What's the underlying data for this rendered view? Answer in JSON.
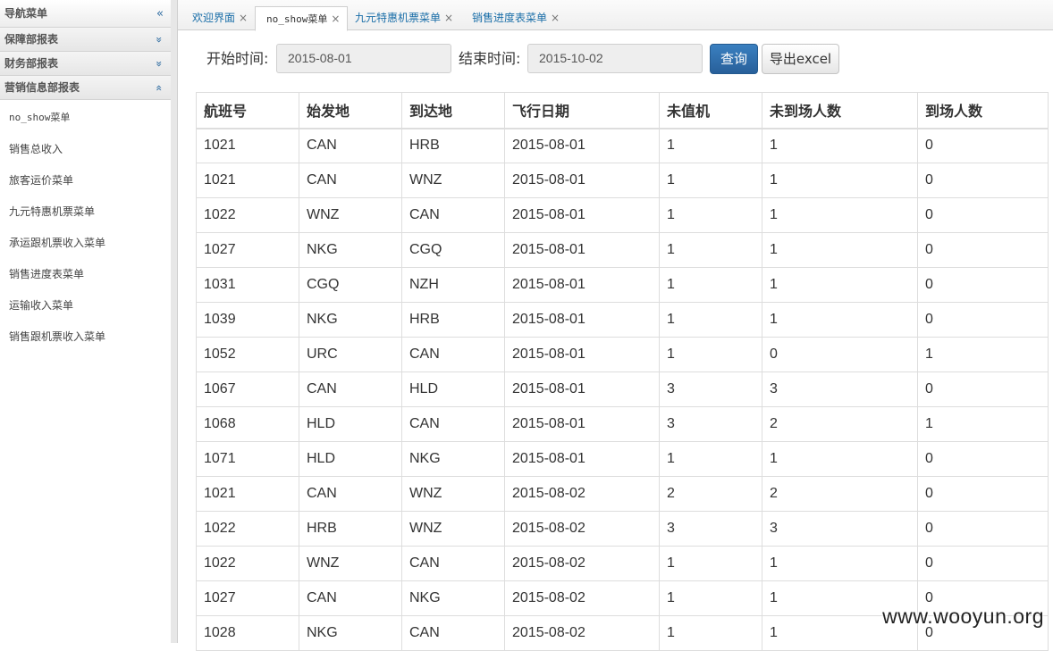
{
  "sidebar": {
    "title": "导航菜单",
    "collapse_icon": "«",
    "groups": [
      {
        "label": "保障部报表",
        "icon": "»"
      },
      {
        "label": "财务部报表",
        "icon": "»"
      },
      {
        "label": "营销信息部报表",
        "icon": "«"
      }
    ],
    "items": [
      {
        "label": "no_show菜单"
      },
      {
        "label": "销售总收入"
      },
      {
        "label": "旅客运价菜单"
      },
      {
        "label": "九元特惠机票菜单"
      },
      {
        "label": "承运跟机票收入菜单"
      },
      {
        "label": "销售进度表菜单"
      },
      {
        "label": "运输收入菜单"
      },
      {
        "label": "销售跟机票收入菜单"
      }
    ]
  },
  "tabs": [
    {
      "label": "欢迎界面",
      "close": "×"
    },
    {
      "label": "no_show菜单",
      "close": "×"
    },
    {
      "label": "九元特惠机票菜单",
      "close": "×"
    },
    {
      "label": "销售进度表菜单",
      "close": "×"
    }
  ],
  "filter": {
    "start_label": "开始时间:",
    "start_value": "2015-08-01",
    "end_label": "结束时间:",
    "end_value": "2015-10-02",
    "query_label": "查询",
    "export_label": "导出excel"
  },
  "table": {
    "headers": [
      "航班号",
      "始发地",
      "到达地",
      "飞行日期",
      "未值机",
      "未到场人数",
      "到场人数"
    ],
    "rows": [
      [
        "1021",
        "CAN",
        "HRB",
        "2015-08-01",
        "1",
        "1",
        "0"
      ],
      [
        "1021",
        "CAN",
        "WNZ",
        "2015-08-01",
        "1",
        "1",
        "0"
      ],
      [
        "1022",
        "WNZ",
        "CAN",
        "2015-08-01",
        "1",
        "1",
        "0"
      ],
      [
        "1027",
        "NKG",
        "CGQ",
        "2015-08-01",
        "1",
        "1",
        "0"
      ],
      [
        "1031",
        "CGQ",
        "NZH",
        "2015-08-01",
        "1",
        "1",
        "0"
      ],
      [
        "1039",
        "NKG",
        "HRB",
        "2015-08-01",
        "1",
        "1",
        "0"
      ],
      [
        "1052",
        "URC",
        "CAN",
        "2015-08-01",
        "1",
        "0",
        "1"
      ],
      [
        "1067",
        "CAN",
        "HLD",
        "2015-08-01",
        "3",
        "3",
        "0"
      ],
      [
        "1068",
        "HLD",
        "CAN",
        "2015-08-01",
        "3",
        "2",
        "1"
      ],
      [
        "1071",
        "HLD",
        "NKG",
        "2015-08-01",
        "1",
        "1",
        "0"
      ],
      [
        "1021",
        "CAN",
        "WNZ",
        "2015-08-02",
        "2",
        "2",
        "0"
      ],
      [
        "1022",
        "HRB",
        "WNZ",
        "2015-08-02",
        "3",
        "3",
        "0"
      ],
      [
        "1022",
        "WNZ",
        "CAN",
        "2015-08-02",
        "1",
        "1",
        "0"
      ],
      [
        "1027",
        "CAN",
        "NKG",
        "2015-08-02",
        "1",
        "1",
        "0"
      ],
      [
        "1028",
        "NKG",
        "CAN",
        "2015-08-02",
        "1",
        "1",
        "0"
      ]
    ]
  },
  "watermark": "www.wooyun.org"
}
